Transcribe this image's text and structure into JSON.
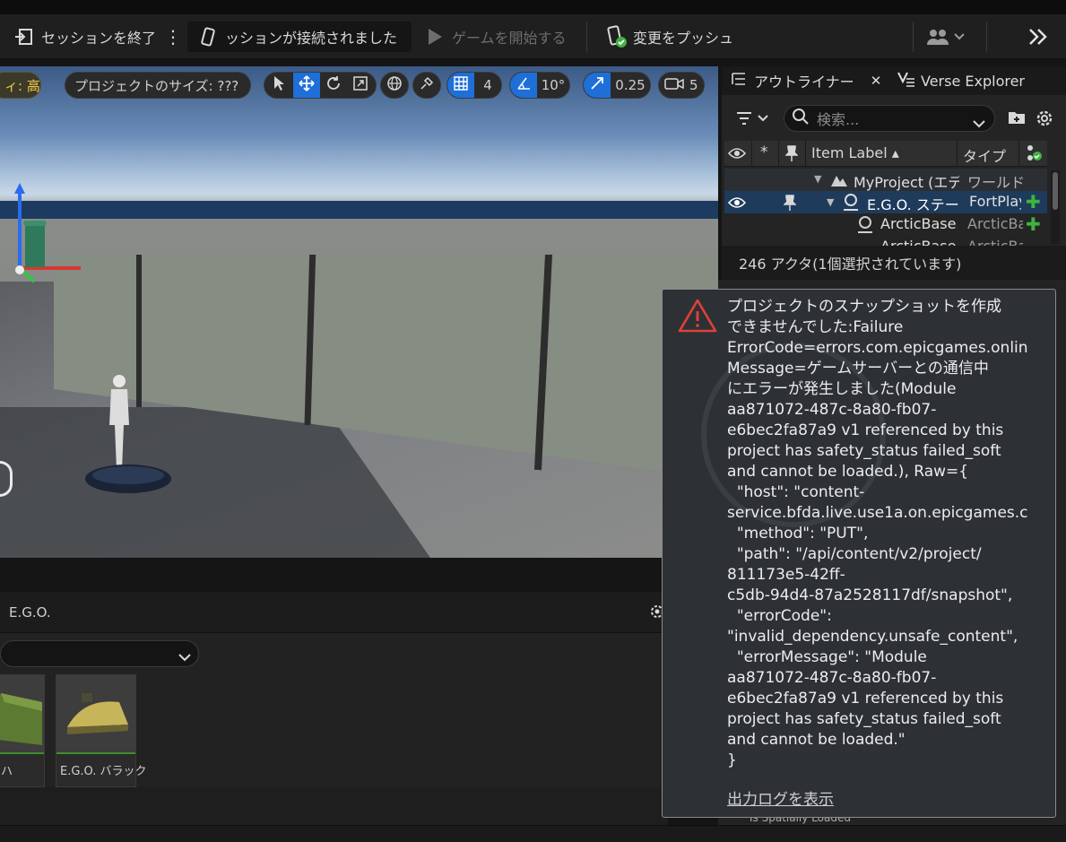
{
  "toolbar": {
    "end_session_label": "セッションを終了",
    "session_status": "ッションが接続されました",
    "start_game_label": "ゲームを開始する",
    "push_changes_label": "変更をプッシュ"
  },
  "viewport": {
    "quality_label": "ィ: 高",
    "project_size_label": "プロジェクトのサイズ: ???",
    "grid_snap_value": "4",
    "rotation_snap_value": "10°",
    "scale_snap_value": "0.25",
    "camera_speed_value": "5"
  },
  "outliner": {
    "tab_label": "アウトライナー",
    "verse_tab_label": "Verse Explorer",
    "search_placeholder": "検索...",
    "columns": {
      "item_label": "Item Label",
      "type": "タイプ"
    },
    "rows": [
      {
        "label": "MyProject (エデ",
        "type": "ワールド"
      },
      {
        "label": "E.G.O. ステー:",
        "type": "FortPlay"
      },
      {
        "label": "ArcticBase",
        "type": "ArcticBa"
      },
      {
        "label": "ArcticBase",
        "type": "ArcticBa"
      }
    ],
    "status": "246 アクタ(1個選択されています)"
  },
  "content": {
    "breadcrumb": "E.G.O.",
    "assets": [
      {
        "label": "ハ"
      },
      {
        "label": "E.G.O. バラック"
      }
    ]
  },
  "bottom_bar": {
    "details_row": "Is Spatially Loaded"
  },
  "toast": {
    "message": "プロジェクトのスナップショットを作成\nできませんでした:Failure\nErrorCode=errors.com.epicgames.onlin\nMessage=ゲームサーバーとの通信中\nにエラーが発生しました(Module\naa871072-487c-8a80-fb07-\ne6bec2fa87a9 v1 referenced by this\nproject has safety_status failed_soft\nand cannot be loaded.), Raw={\n  \"host\": \"content-\nservice.bfda.live.use1a.on.epicgames.c\n  \"method\": \"PUT\",\n  \"path\": \"/api/content/v2/project/\n811173e5-42ff-\nc5db-94d4-87a2528117df/snapshot\",\n  \"errorCode\":\n\"invalid_dependency.unsafe_content\",\n  \"errorMessage\": \"Module\naa871072-487c-8a80-fb07-\ne6bec2fa87a9 v1 referenced by this\nproject has safety_status failed_soft\nand cannot be loaded.\"\n}",
    "link_label": "出力ログを表示"
  },
  "colors": {
    "accent": "#1f6fd8",
    "selection": "#1e3b5c",
    "warning": "#e0403a",
    "green": "#3fb33f"
  }
}
